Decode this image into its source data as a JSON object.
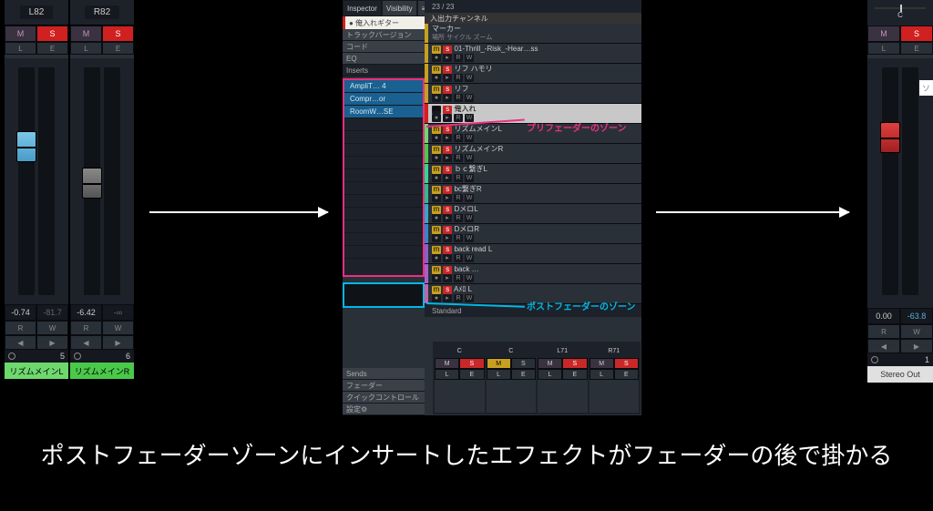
{
  "caption": "ポストフェーダーゾーンにインサートしたエフェクトがフェーダーの後で掛かる",
  "strip1": {
    "pan": "L82",
    "m": "M",
    "s": "S",
    "l": "L",
    "e": "E",
    "val": "-0.74",
    "peak": "-81.7",
    "r": "R",
    "w": "W",
    "num": "5",
    "name": "リズムメインL"
  },
  "strip2": {
    "pan": "R82",
    "m": "M",
    "s": "S",
    "l": "L",
    "e": "E",
    "val": "-6.42",
    "peak": "-∞",
    "r": "R",
    "w": "W",
    "num": "6",
    "name": "リズムメインR"
  },
  "inspector": {
    "tabs": {
      "inspector": "Inspector",
      "visibility": "Visibility"
    },
    "header": "● 俺入れギター",
    "sections": [
      "トラックバージョン",
      "コード",
      "EQ",
      "Inserts"
    ],
    "inserts": [
      "AmpliT… 4",
      "Compr…or",
      "RoomW…SE"
    ],
    "bottom": [
      "Sends",
      "フェーダー",
      "クイックコントロール"
    ],
    "setting": "設定"
  },
  "tracks": {
    "count": "23 / 23",
    "io": "入出力チャンネル",
    "marker": "マーカー",
    "marker_sub": "場所 サイクル ズーム",
    "rows": [
      {
        "color": "#c8a020",
        "name": "01-Thrill_-Risk_-Hear…ss"
      },
      {
        "color": "#c8a020",
        "name": "リフ ハモリ"
      },
      {
        "color": "#c8a020",
        "name": "リフ"
      },
      {
        "color": "#d02020",
        "name": "俺入れ",
        "sel": true
      },
      {
        "color": "#6dd86d",
        "name": "リズムメインL"
      },
      {
        "color": "#4ac84a",
        "name": "リズムメインR"
      },
      {
        "color": "#30d890",
        "name": "ｂｃ繋ぎL"
      },
      {
        "color": "#30b890",
        "name": "bc繋ぎR"
      },
      {
        "color": "#30a8c8",
        "name": "DメロL"
      },
      {
        "color": "#3088c8",
        "name": "DメロR"
      },
      {
        "color": "#8860c8",
        "name": "back read L"
      },
      {
        "color": "#a860c8",
        "name": "back …"
      },
      {
        "color": "#c860a8",
        "name": "Aﾒﾛ L"
      }
    ],
    "standard": "Standard"
  },
  "anno": {
    "pre": "プリフェーダーのゾーン",
    "post": "ポストフェーダーのゾーン"
  },
  "mini": {
    "pans": [
      "C",
      "C",
      "L71",
      "R71"
    ],
    "m": "M",
    "s": "S",
    "l": "L",
    "e": "E"
  },
  "stripR": {
    "c": "C",
    "m": "M",
    "s": "S",
    "l": "L",
    "e": "E",
    "val": "0.00",
    "peak": "-63.8",
    "r": "R",
    "w": "W",
    "num": "1",
    "name": "Stereo Out",
    "so": "ソ"
  }
}
